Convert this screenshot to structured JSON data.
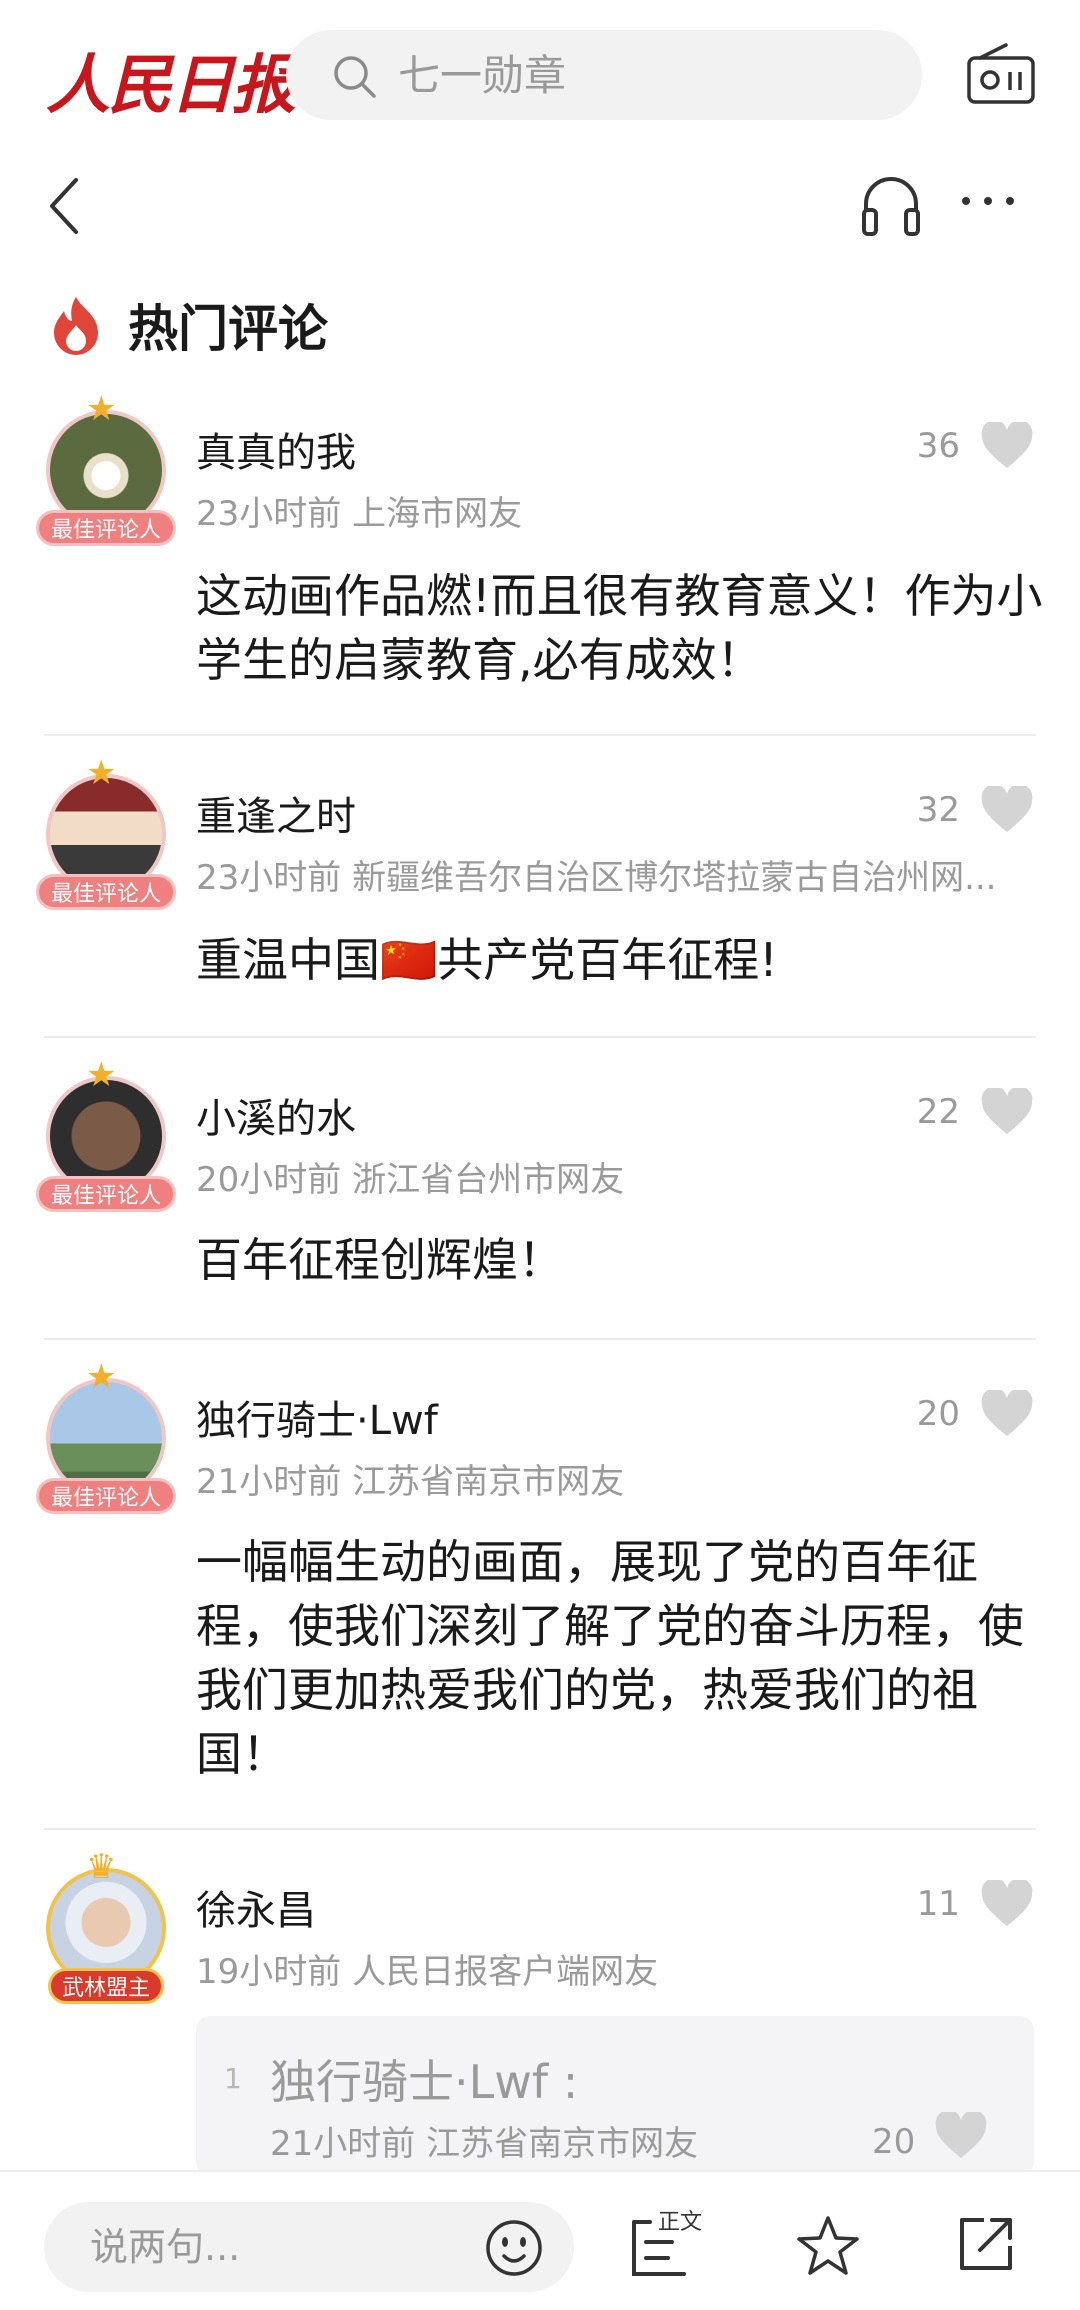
{
  "header": {
    "logo_text": "人民日报",
    "search_placeholder": "七一勋章"
  },
  "section": {
    "title": "热门评论"
  },
  "comments": [
    {
      "name": "真真的我",
      "meta": "23小时前  上海市网友",
      "likes": "36",
      "badge": "最佳评论人",
      "text": "这动画作品燃!而且很有教育意义！作为小学生的启蒙教育,必有成效！"
    },
    {
      "name": "重逢之时",
      "meta": "23小时前  新疆维吾尔自治区博尔塔拉蒙古自治州网...",
      "likes": "32",
      "badge": "最佳评论人",
      "text": "重温中国🇨🇳共产党百年征程!"
    },
    {
      "name": "小溪的水",
      "meta": "20小时前  浙江省台州市网友",
      "likes": "22",
      "badge": "最佳评论人",
      "text": "百年征程创辉煌！"
    },
    {
      "name": "独行骑士·Lwf",
      "meta": "21小时前  江苏省南京市网友",
      "likes": "20",
      "badge": "最佳评论人",
      "text": "一幅幅生动的画面，展现了党的百年征程，使我们深刻了解了党的奋斗历程，使我们更加热爱我们的党，热爱我们的祖国！"
    },
    {
      "name": "徐永昌",
      "meta": "19小时前  人民日报客户端网友",
      "likes": "11",
      "badge": "武林盟主",
      "reply": {
        "index": "1",
        "name": "独行骑士·Lwf :",
        "meta": "21小时前  江苏省南京市网友",
        "likes": "20"
      }
    }
  ],
  "bottombar": {
    "input_placeholder": "说两句...",
    "article_label": "正文"
  },
  "colors": {
    "brand_red": "#c8161d",
    "muted_gray": "#9a9a9a"
  }
}
